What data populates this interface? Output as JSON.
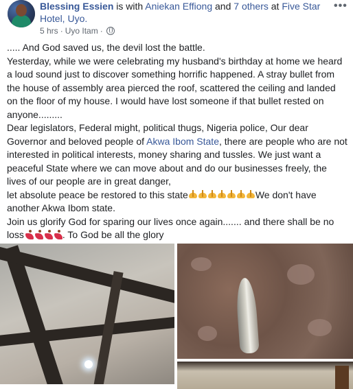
{
  "header": {
    "author": "Blessing Essien",
    "with_text": " is with ",
    "tagged": "Aniekan Effiong",
    "and_text": " and ",
    "others": "7 others",
    "at_text": " at ",
    "place": "Five Star Hotel, Uyo.",
    "time": "5 hrs",
    "separator": "·",
    "location": "Uyo Itam",
    "separator2": "·",
    "privacy_icon": "globe-icon",
    "more_label": "•••"
  },
  "post": {
    "line1": "..... And God saved us, the devil lost the battle.",
    "para2": "Yesterday, while we were celebrating my husband's birthday at home we heard a loud sound just to discover something horrific happened. A stray bullet from the house of assembly area pierced the roof, scattered the ceiling and landed on the floor of my house. I would have lost someone if that bullet rested on anyone.........",
    "para3_a": "Dear legislators, Federal might, political thugs, Nigeria police, Our dear Governor and beloved people of ",
    "para3_link": "Akwa Ibom State",
    "para3_b": ", there are people who are not interested in political interests, money sharing and tussles. We just want a peaceful State where we can move about and do our businesses freely, the lives of our people are in great danger,",
    "para4_a": "let absolute peace be restored to this state",
    "para4_b": "We don't have another Akwa Ibom state.",
    "para5_a": "Join us glorify God for sparing our lives once again....... and there shall be no loss",
    "para5_b": ". To God be all the glory",
    "emoji_pray": "folded-hands-icon",
    "emoji_dancer": "dancer-icon"
  },
  "photos": {
    "count": 3,
    "items": [
      "ceiling-photo",
      "bullet-photo",
      "floor-photo"
    ]
  },
  "colors": {
    "link": "#385898",
    "text": "#1c1e21",
    "meta": "#606770"
  }
}
